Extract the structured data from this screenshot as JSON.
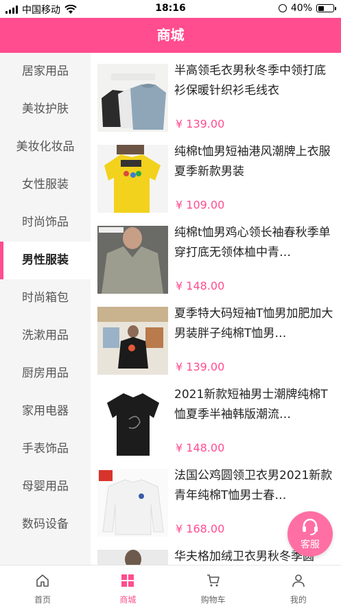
{
  "status_bar": {
    "carrier": "中国移动",
    "time": "18:16",
    "battery": "40%"
  },
  "header": {
    "title": "商城"
  },
  "categories": [
    {
      "label": "居家用品"
    },
    {
      "label": "美妆护肤"
    },
    {
      "label": "美妆化妆品"
    },
    {
      "label": "女性服装"
    },
    {
      "label": "时尚饰品"
    },
    {
      "label": "男性服装",
      "active": true
    },
    {
      "label": "时尚箱包"
    },
    {
      "label": "洗漱用品"
    },
    {
      "label": "厨房用品"
    },
    {
      "label": "家用电器"
    },
    {
      "label": "手表饰品"
    },
    {
      "label": "母婴用品"
    },
    {
      "label": "数码设备"
    }
  ],
  "products": [
    {
      "title": "半高领毛衣男秋冬季中领打底衫保暖针织衫毛线衣",
      "price": "¥ 139.00",
      "image": "knit-sweaters"
    },
    {
      "title": "纯棉t恤男短袖港风潮牌上衣服夏季新款男装",
      "price": "¥ 109.00",
      "image": "yellow-tshirt"
    },
    {
      "title": "纯棉t恤男鸡心领长袖春秋季单穿打底无领体桖中青…",
      "price": "¥ 148.00",
      "image": "grey-longsleeve"
    },
    {
      "title": "夏季特大码短袖T恤男加肥加大男装胖子纯棉T恤男…",
      "price": "¥ 139.00",
      "image": "plus-size-tshirt"
    },
    {
      "title": "2021新款短袖男士潮牌纯棉T恤夏季半袖韩版潮流…",
      "price": "¥ 148.00",
      "image": "black-tshirt"
    },
    {
      "title": "法国公鸡圆领卫衣男2021新款青年纯棉T恤男士春…",
      "price": "¥ 168.00",
      "image": "white-sweatshirt"
    },
    {
      "title": "华夫格加绒卫衣男秋冬季圆",
      "price": "",
      "image": "waffle-sweatshirt"
    }
  ],
  "service_button": {
    "label": "客服"
  },
  "tabbar": [
    {
      "label": "首页",
      "icon": "home-icon"
    },
    {
      "label": "商城",
      "icon": "grid-icon",
      "active": true
    },
    {
      "label": "购物车",
      "icon": "cart-icon"
    },
    {
      "label": "我的",
      "icon": "user-icon"
    }
  ],
  "colors": {
    "accent": "#ff4d8f",
    "sidebar_bg": "#f5f5f5"
  }
}
